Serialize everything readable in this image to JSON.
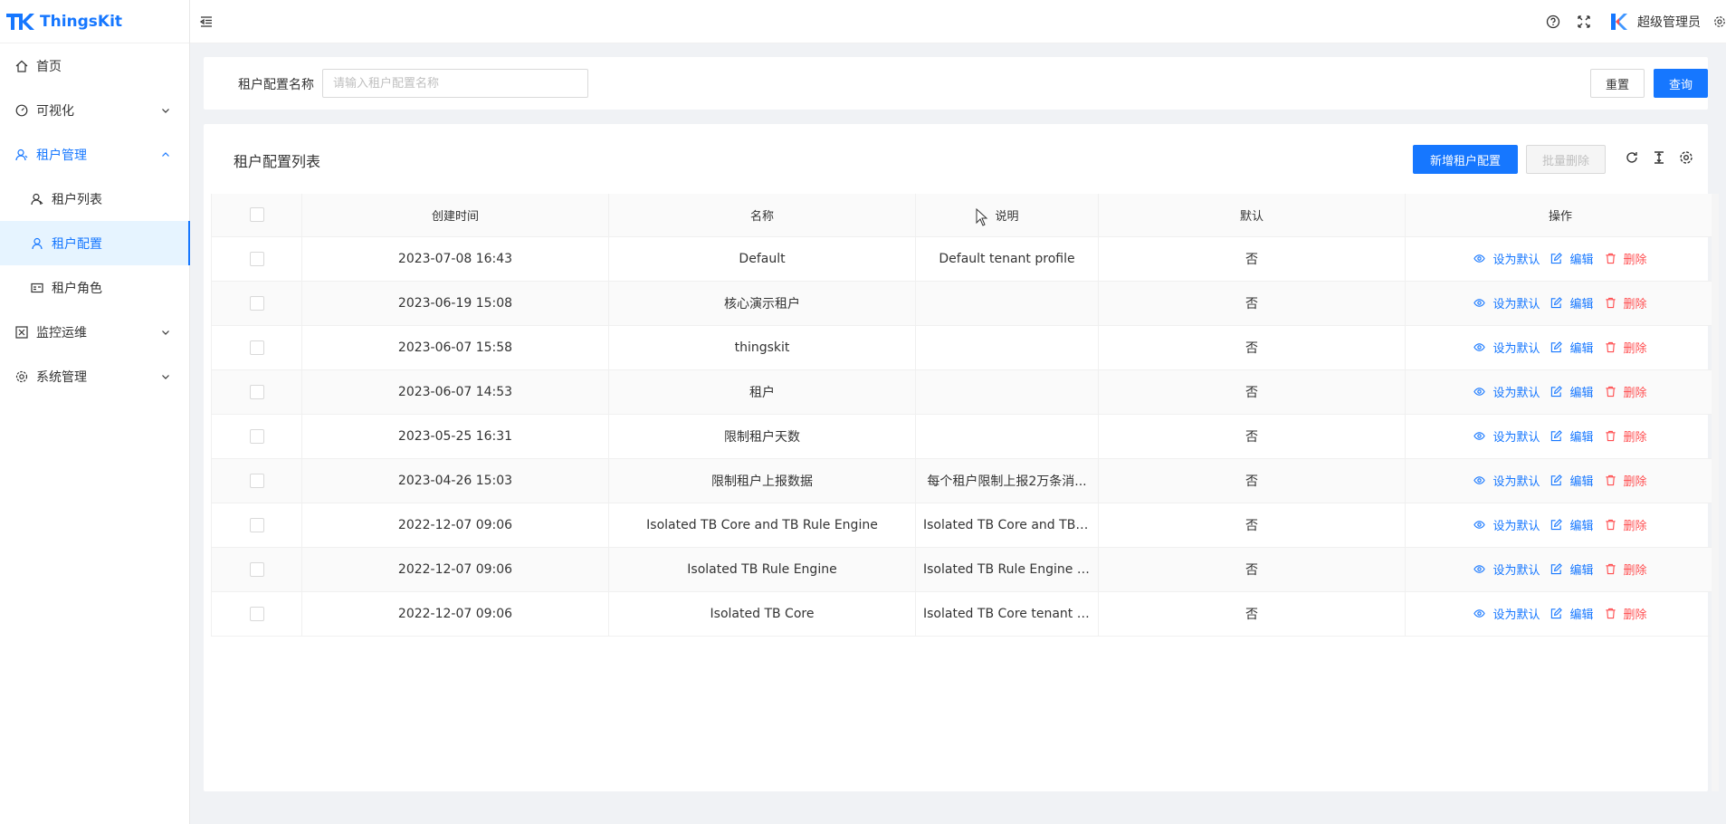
{
  "app": {
    "name": "ThingsKit"
  },
  "sidebar": {
    "items": [
      {
        "label": "首页"
      },
      {
        "label": "可视化"
      },
      {
        "label": "租户管理"
      },
      {
        "label": "租户列表"
      },
      {
        "label": "租户配置"
      },
      {
        "label": "租户角色"
      },
      {
        "label": "监控运维"
      },
      {
        "label": "系统管理"
      }
    ]
  },
  "header": {
    "username": "超级管理员"
  },
  "search": {
    "label": "租户配置名称",
    "placeholder": "请输入租户配置名称",
    "reset_label": "重置",
    "query_label": "查询"
  },
  "table_card": {
    "title": "租户配置列表",
    "add_label": "新增租户配置",
    "batch_delete_label": "批量删除"
  },
  "table": {
    "columns": [
      "创建时间",
      "名称",
      "说明",
      "默认",
      "操作"
    ],
    "actions": {
      "set_default": "设为默认",
      "edit": "编辑",
      "delete": "删除"
    },
    "rows": [
      {
        "created": "2023-07-08 16:43",
        "name": "Default",
        "desc": "Default tenant profile",
        "default": "否"
      },
      {
        "created": "2023-06-19 15:08",
        "name": "核心演示租户",
        "desc": "",
        "default": "否"
      },
      {
        "created": "2023-06-07 15:58",
        "name": "thingskit",
        "desc": "",
        "default": "否"
      },
      {
        "created": "2023-06-07 14:53",
        "name": "租户",
        "desc": "",
        "default": "否"
      },
      {
        "created": "2023-05-25 16:31",
        "name": "限制租户天数",
        "desc": "",
        "default": "否"
      },
      {
        "created": "2023-04-26 15:03",
        "name": "限制租户上报数据",
        "desc": "每个租户限制上报2万条消...",
        "default": "否"
      },
      {
        "created": "2022-12-07 09:06",
        "name": "Isolated TB Core and TB Rule Engine",
        "desc": "Isolated TB Core and TB R...",
        "default": "否"
      },
      {
        "created": "2022-12-07 09:06",
        "name": "Isolated TB Rule Engine",
        "desc": "Isolated TB Rule Engine t...",
        "default": "否"
      },
      {
        "created": "2022-12-07 09:06",
        "name": "Isolated TB Core",
        "desc": "Isolated TB Core tenant p...",
        "default": "否"
      }
    ]
  }
}
